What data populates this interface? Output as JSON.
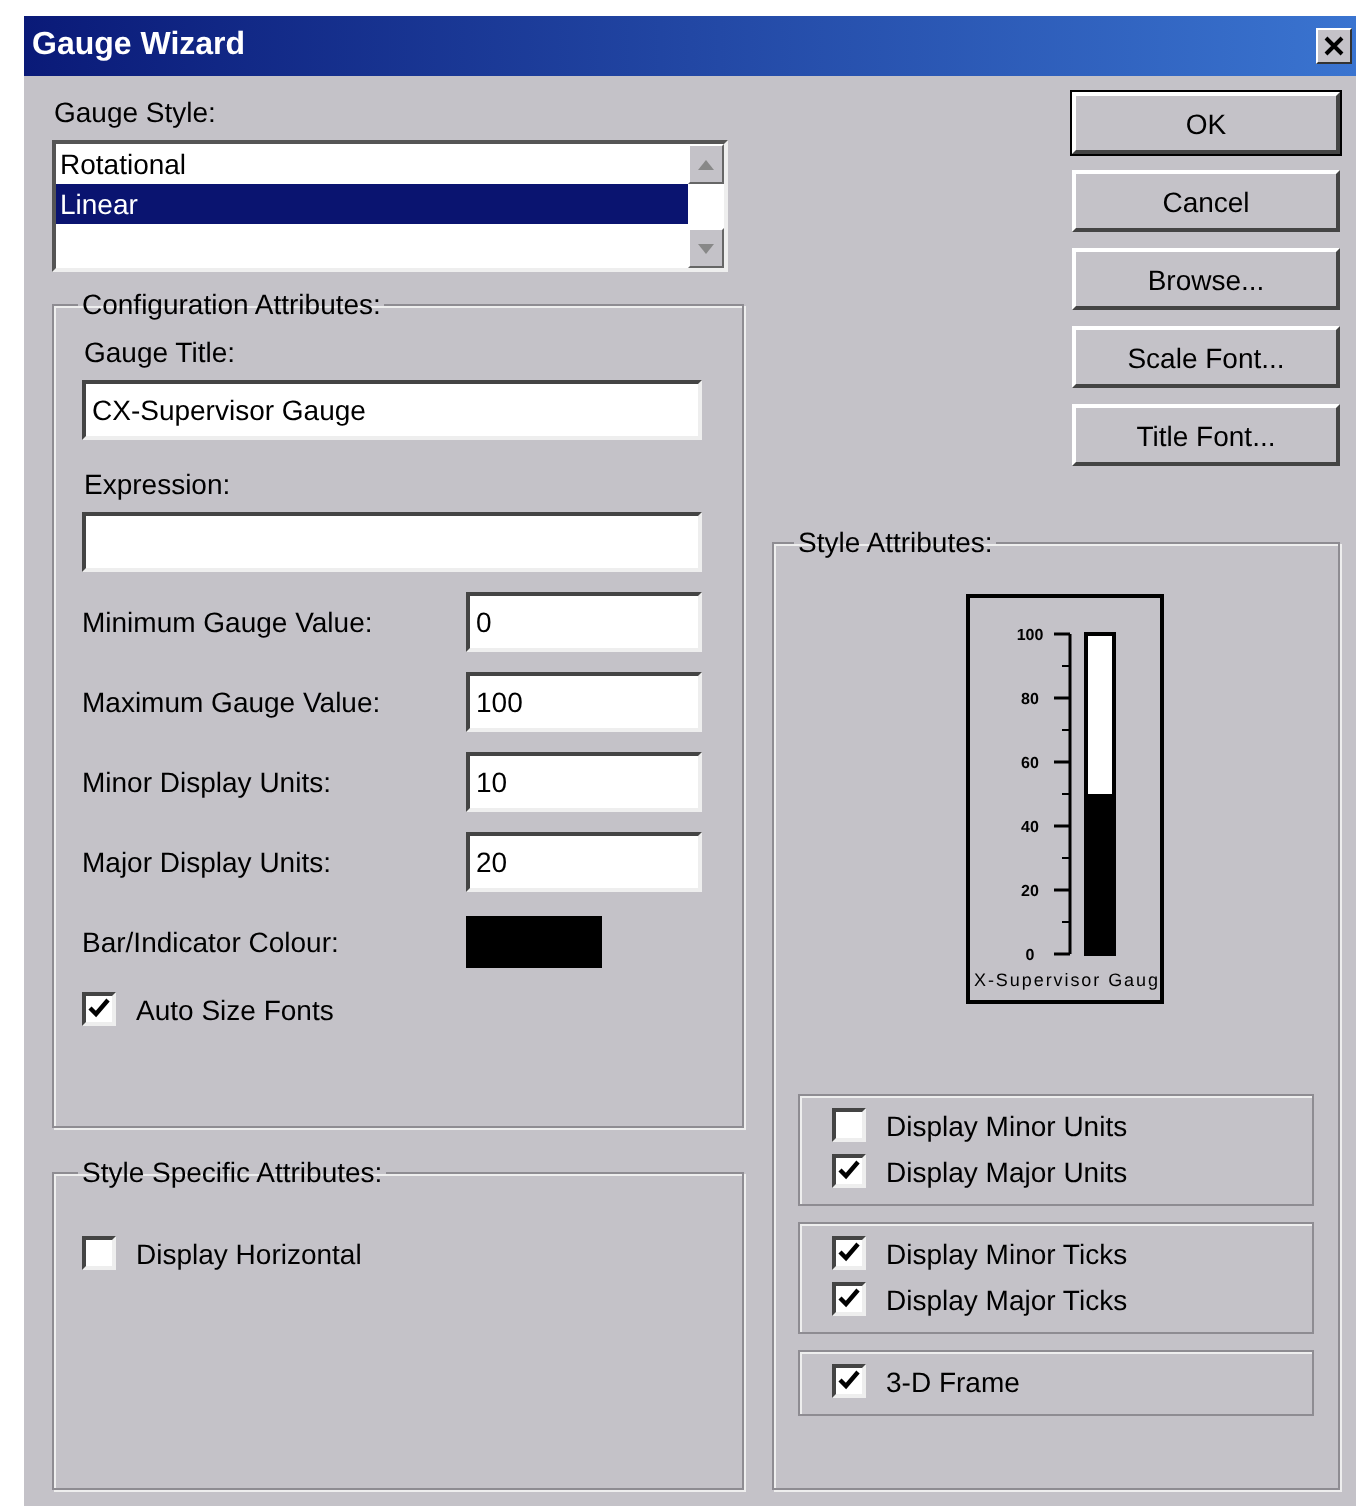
{
  "window": {
    "title": "Gauge Wizard"
  },
  "gauge_style": {
    "label": "Gauge Style:",
    "items": [
      {
        "label": "Rotational",
        "selected": false
      },
      {
        "label": "Linear",
        "selected": true
      }
    ]
  },
  "configuration": {
    "title": "Configuration Attributes:",
    "gauge_title": {
      "label": "Gauge Title:",
      "value": "CX-Supervisor Gauge"
    },
    "expression": {
      "label": "Expression:"
    },
    "fields": [
      {
        "label": "Minimum Gauge Value:",
        "value": "0"
      },
      {
        "label": "Maximum Gauge Value:",
        "value": "100"
      },
      {
        "label": "Minor Display Units:",
        "value": "10"
      },
      {
        "label": "Major Display Units:",
        "value": "20"
      }
    ],
    "colour": {
      "label": "Bar/Indicator Colour:",
      "color": "#000000"
    },
    "auto_size": {
      "label": "Auto Size Fonts",
      "checked": true
    }
  },
  "style_specific": {
    "title": "Style Specific Attributes:",
    "options": [
      {
        "label": "Display Horizontal",
        "checked": false
      }
    ]
  },
  "buttons": [
    "OK",
    "Cancel",
    "Browse...",
    "Scale Font...",
    "Title Font..."
  ],
  "style_attributes": {
    "title": "Style Attributes:",
    "preview": {
      "scale_labels": [
        "100",
        "80",
        "60",
        "40",
        "20",
        "0"
      ],
      "level": 0.5,
      "caption": "X-Supervisor Gaug"
    },
    "groups": [
      {
        "options": [
          {
            "label": "Display Minor Units",
            "checked": false
          },
          {
            "label": "Display Major Units",
            "checked": true
          }
        ]
      },
      {
        "options": [
          {
            "label": "Display Minor Ticks",
            "checked": true
          },
          {
            "label": "Display Major Ticks",
            "checked": true
          }
        ]
      },
      {
        "options": [
          {
            "label": "3-D Frame",
            "checked": true
          }
        ]
      }
    ]
  }
}
